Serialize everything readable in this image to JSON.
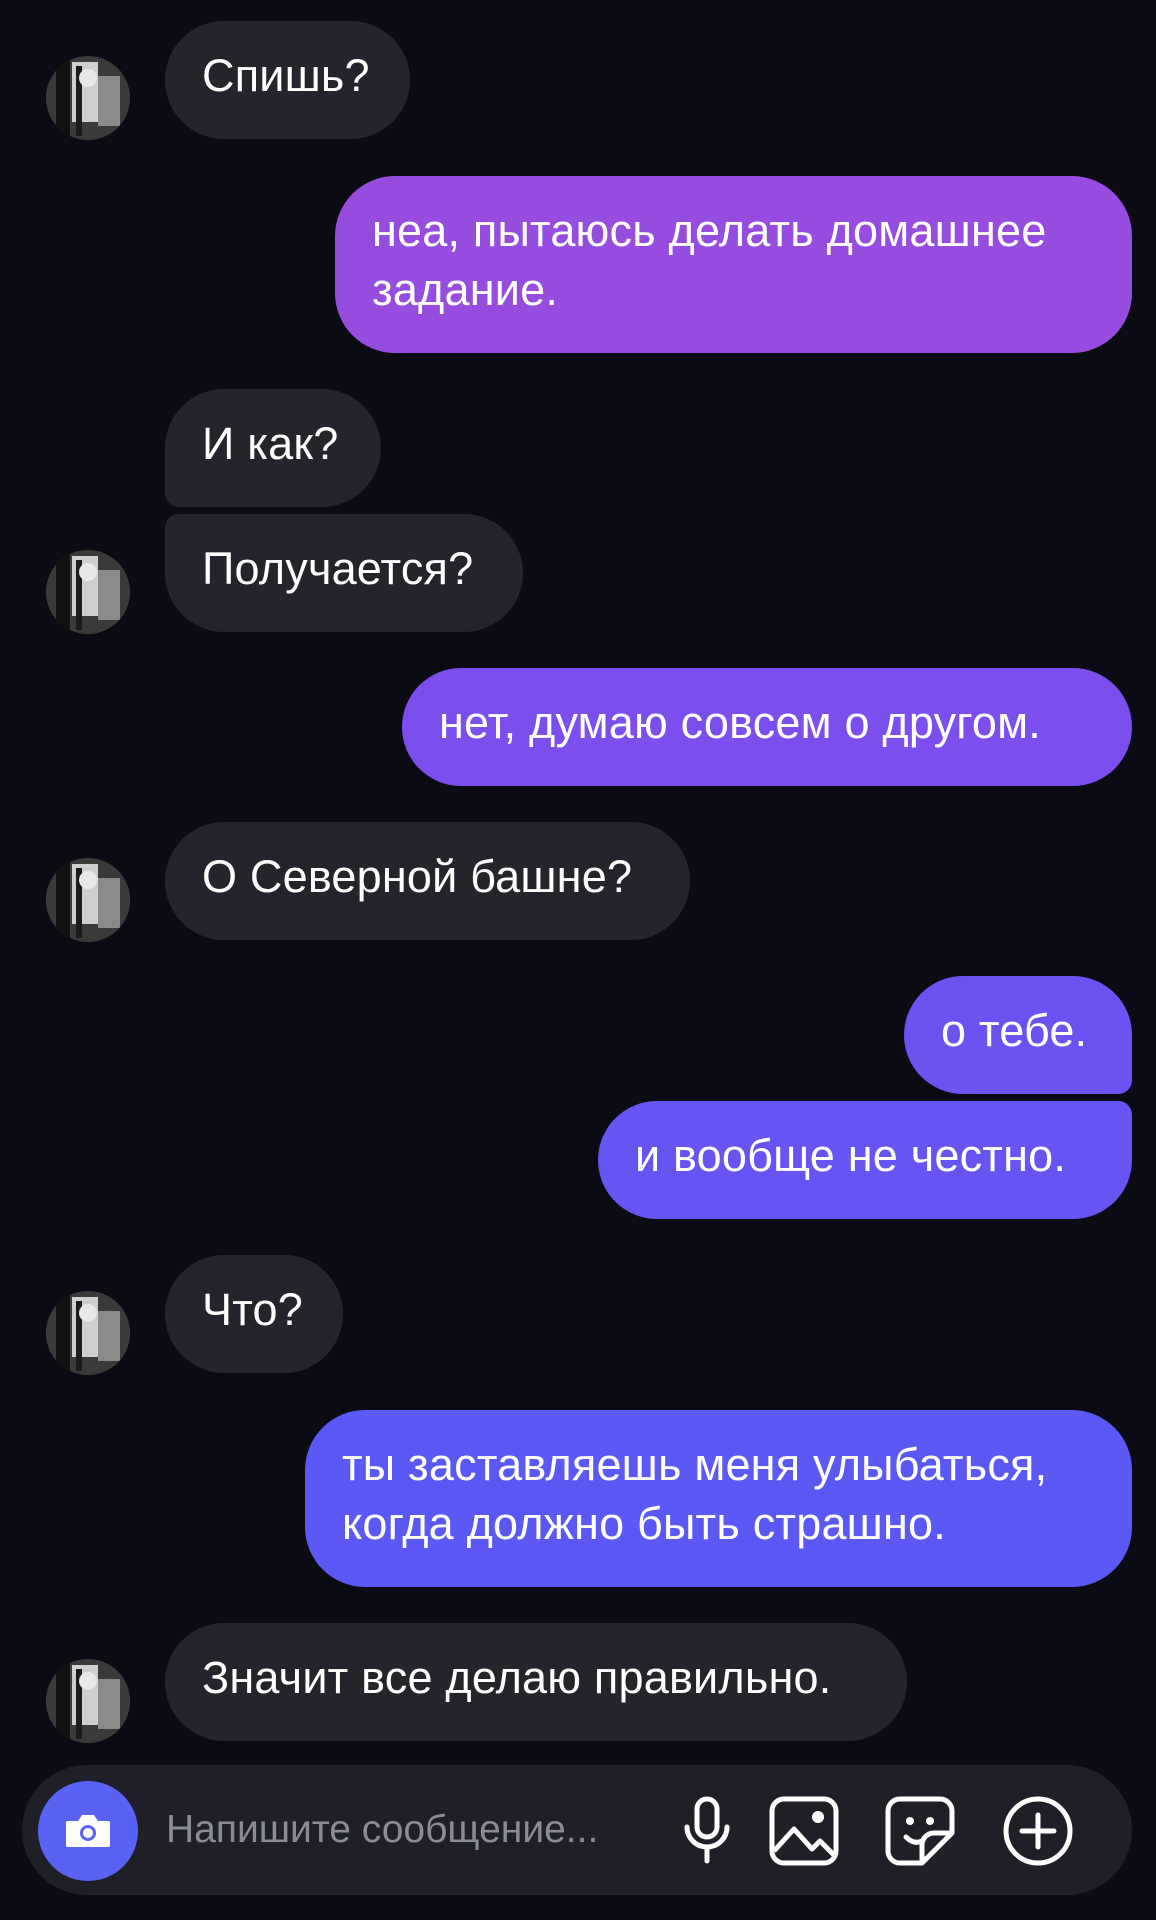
{
  "chat": {
    "messages": [
      {
        "side": "in",
        "text": "Спишь?"
      },
      {
        "side": "out",
        "text": "неа, пытаюсь делать домашнее\nзадание."
      },
      {
        "side": "in",
        "text": "И как?"
      },
      {
        "side": "in",
        "text": "Получается?"
      },
      {
        "side": "out",
        "text": "нет, думаю совсем о другом."
      },
      {
        "side": "in",
        "text": "О Северной башне?"
      },
      {
        "side": "out",
        "text": "о тебе."
      },
      {
        "side": "out",
        "text": "и вообще не честно."
      },
      {
        "side": "in",
        "text": "Что?"
      },
      {
        "side": "out",
        "text": "ты заставляешь меня улыбаться,\nкогда должно быть страшно."
      },
      {
        "side": "in",
        "text": "Значит все делаю правильно."
      }
    ]
  },
  "composer": {
    "placeholder": "Напишите сообщение...",
    "camera_icon": "camera-icon",
    "mic_icon": "microphone-icon",
    "image_icon": "image-icon",
    "sticker_icon": "sticker-icon",
    "add_icon": "plus-circle-icon"
  },
  "colors": {
    "background": "#0b0c13",
    "incoming_bubble": "#24252c",
    "outgoing_gradient_top": "#9b4be0",
    "outgoing_gradient_bottom": "#5b58f5",
    "accent": "#5a62f5"
  }
}
